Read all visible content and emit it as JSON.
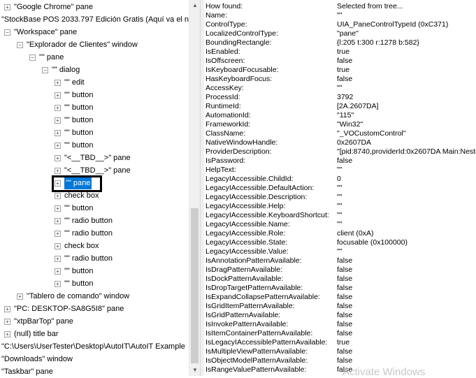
{
  "tree": {
    "items": [
      {
        "label": "\"Google Chrome\" pane",
        "indent": 0,
        "expander": "plus"
      },
      {
        "label": "\"StockBase POS 2033.797 Edición Gratis (Aquí va el no",
        "indent": -1,
        "expander": "none"
      },
      {
        "label": "\"Workspace\" pane",
        "indent": 0,
        "expander": "minus"
      },
      {
        "label": "\"Explorador de Clientes\" window",
        "indent": 1,
        "expander": "minus"
      },
      {
        "label": "\"\" pane",
        "indent": 2,
        "expander": "minus"
      },
      {
        "label": "\"\" dialog",
        "indent": 3,
        "expander": "minus"
      },
      {
        "label": "\"\" edit",
        "indent": 4,
        "expander": "plus"
      },
      {
        "label": "\"\" button",
        "indent": 4,
        "expander": "plus"
      },
      {
        "label": "\"\" button",
        "indent": 4,
        "expander": "plus"
      },
      {
        "label": "\"\" button",
        "indent": 4,
        "expander": "plus"
      },
      {
        "label": "\"\" button",
        "indent": 4,
        "expander": "plus"
      },
      {
        "label": "\"\" button",
        "indent": 4,
        "expander": "plus"
      },
      {
        "label": "\"<__TBD__>\" pane",
        "indent": 4,
        "expander": "plus"
      },
      {
        "label": "\"<__TBD__>\" pane",
        "indent": 4,
        "expander": "plus"
      },
      {
        "label": "\"\" pane",
        "indent": 4,
        "expander": "plus",
        "selected": true
      },
      {
        "label": "check box",
        "indent": 4,
        "expander": "plus"
      },
      {
        "label": "\"\" button",
        "indent": 4,
        "expander": "plus"
      },
      {
        "label": "\"\" radio button",
        "indent": 4,
        "expander": "plus"
      },
      {
        "label": "\"\" radio button",
        "indent": 4,
        "expander": "plus"
      },
      {
        "label": "check box",
        "indent": 4,
        "expander": "plus"
      },
      {
        "label": "\"\" radio button",
        "indent": 4,
        "expander": "plus"
      },
      {
        "label": "\"\" button",
        "indent": 4,
        "expander": "plus"
      },
      {
        "label": "\"\" button",
        "indent": 4,
        "expander": "plus"
      },
      {
        "label": "\"Tablero de comando\" window",
        "indent": 1,
        "expander": "plus"
      },
      {
        "label": "\"PC: DESKTOP-SA8G5I8\" pane",
        "indent": 0,
        "expander": "plus"
      },
      {
        "label": "\"xtpBarTop\" pane",
        "indent": 0,
        "expander": "plus"
      },
      {
        "label": "(null) title bar",
        "indent": 0,
        "expander": "plus"
      },
      {
        "label": "\"C:\\Users\\UserTester\\Desktop\\AutoIT\\AutoIT Example",
        "indent": -1,
        "expander": "none"
      },
      {
        "label": "\"Downloads\" window",
        "indent": -1,
        "expander": "none"
      },
      {
        "label": "\"Taskbar\" pane",
        "indent": -1,
        "expander": "none"
      }
    ]
  },
  "properties": [
    {
      "name": "How found:",
      "value": "Selected from tree..."
    },
    {
      "name": "Name:",
      "value": "\"\""
    },
    {
      "name": "ControlType:",
      "value": "UIA_PaneControlTypeId (0xC371)"
    },
    {
      "name": "LocalizedControlType:",
      "value": "\"pane\""
    },
    {
      "name": "BoundingRectangle:",
      "value": "{l:205 t:300 r:1278 b:582}"
    },
    {
      "name": "IsEnabled:",
      "value": "true"
    },
    {
      "name": "IsOffscreen:",
      "value": "false"
    },
    {
      "name": "IsKeyboardFocusable:",
      "value": "true"
    },
    {
      "name": "HasKeyboardFocus:",
      "value": "false"
    },
    {
      "name": "AccessKey:",
      "value": "\"\""
    },
    {
      "name": "ProcessId:",
      "value": "3792"
    },
    {
      "name": "RuntimeId:",
      "value": "[2A.2607DA]"
    },
    {
      "name": "AutomationId:",
      "value": "\"115\""
    },
    {
      "name": "FrameworkId:",
      "value": "\"Win32\""
    },
    {
      "name": "ClassName:",
      "value": "\"_VOCustomControl\""
    },
    {
      "name": "NativeWindowHandle:",
      "value": "0x2607DA"
    },
    {
      "name": "ProviderDescription:",
      "value": "\"[pid:8740,providerId:0x2607DA Main:Nested"
    },
    {
      "name": "IsPassword:",
      "value": "false"
    },
    {
      "name": "HelpText:",
      "value": "\"\""
    },
    {
      "name": "LegacyIAccessible.ChildId:",
      "value": "0"
    },
    {
      "name": "LegacyIAccessible.DefaultAction:",
      "value": "\"\""
    },
    {
      "name": "LegacyIAccessible.Description:",
      "value": "\"\""
    },
    {
      "name": "LegacyIAccessible.Help:",
      "value": "\"\""
    },
    {
      "name": "LegacyIAccessible.KeyboardShortcut:",
      "value": "\"\""
    },
    {
      "name": "LegacyIAccessible.Name:",
      "value": "\"\""
    },
    {
      "name": "LegacyIAccessible.Role:",
      "value": "client (0xA)"
    },
    {
      "name": "LegacyIAccessible.State:",
      "value": "focusable (0x100000)"
    },
    {
      "name": "LegacyIAccessible.Value:",
      "value": "\"\""
    },
    {
      "name": "IsAnnotationPatternAvailable:",
      "value": "false"
    },
    {
      "name": "IsDragPatternAvailable:",
      "value": "false"
    },
    {
      "name": "IsDockPatternAvailable:",
      "value": "false"
    },
    {
      "name": "IsDropTargetPatternAvailable:",
      "value": "false"
    },
    {
      "name": "IsExpandCollapsePatternAvailable:",
      "value": "false"
    },
    {
      "name": "IsGridItemPatternAvailable:",
      "value": "false"
    },
    {
      "name": "IsGridPatternAvailable:",
      "value": "false"
    },
    {
      "name": "IsInvokePatternAvailable:",
      "value": "false"
    },
    {
      "name": "IsItemContainerPatternAvailable:",
      "value": "false"
    },
    {
      "name": "IsLegacyIAccessiblePatternAvailable:",
      "value": "true"
    },
    {
      "name": "IsMultipleViewPatternAvailable:",
      "value": "false"
    },
    {
      "name": "IsObjectModelPatternAvailable:",
      "value": "false"
    },
    {
      "name": "IsRangeValuePatternAvailable:",
      "value": "false"
    }
  ],
  "watermark": "Activate Windows",
  "colors": {
    "selection": "#0078d7",
    "scrollbar_track": "#f0f0f0",
    "scrollbar_thumb": "#cdcdcd"
  }
}
